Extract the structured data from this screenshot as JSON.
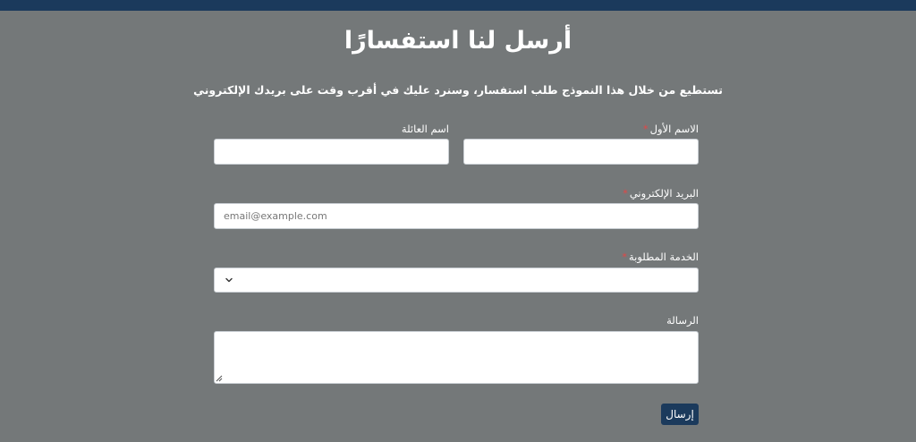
{
  "page": {
    "title": "أرسل لنا استفسارًا",
    "subtitle": "تستطيع من خلال هذا النموذج طلب استفسار، وسنرد عليك في أقرب وقت على بريدك الإلكتروني"
  },
  "form": {
    "first_name": {
      "label": "الاسم الأول",
      "required_mark": "*",
      "value": ""
    },
    "last_name": {
      "label": "اسم العائلة",
      "value": ""
    },
    "email": {
      "label": "البريد الإلكتروني",
      "required_mark": "*",
      "placeholder": "email@example.com",
      "value": ""
    },
    "service": {
      "label": "الخدمة المطلوبة",
      "required_mark": "*",
      "selected": ""
    },
    "message": {
      "label": "الرسالة",
      "value": ""
    },
    "submit_label": "إرسال"
  },
  "colors": {
    "background": "#747879",
    "accent": "#1b3a5c",
    "required": "#e04848"
  },
  "icons": [
    "chevron-down-icon",
    "resize-handle-icon"
  ]
}
